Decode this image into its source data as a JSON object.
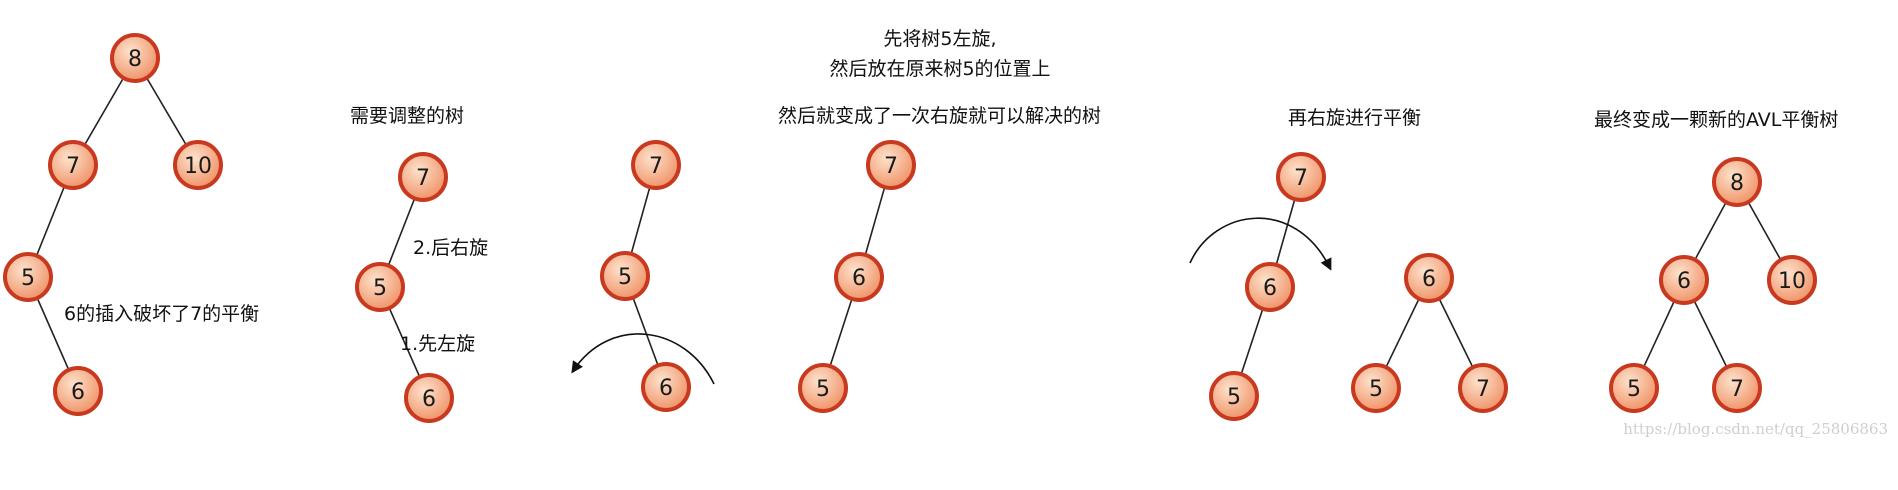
{
  "colors": {
    "node_fill_light": "#fde2cc",
    "node_fill_dark": "#ef8f63",
    "node_stroke": "#c8391f",
    "edge": "#222222",
    "text": "#111111",
    "watermark": "#cfcfcf"
  },
  "diagram": {
    "top_caption": [
      "先将树5左旋,",
      "然后放在原来树5的位置上"
    ],
    "panels": [
      {
        "id": "original",
        "captions": [
          "6的插入破坏了7的平衡"
        ],
        "nodes": [
          "8",
          "7",
          "10",
          "5",
          "6"
        ]
      },
      {
        "id": "subtree",
        "captions": [
          "需要调整的树",
          "2.后右旋",
          "1.先左旋"
        ],
        "nodes": [
          "7",
          "5",
          "6"
        ]
      },
      {
        "id": "left-rotate",
        "captions": [],
        "nodes": [
          "7",
          "5",
          "6"
        ]
      },
      {
        "id": "after-left",
        "captions": [
          "然后就变成了一次右旋就可以解决的树"
        ],
        "nodes": [
          "7",
          "6",
          "5"
        ]
      },
      {
        "id": "right-rotate",
        "captions": [
          "再右旋进行平衡"
        ],
        "nodes": [
          "7",
          "6",
          "5",
          "6",
          "5",
          "7"
        ]
      },
      {
        "id": "final",
        "captions": [
          "最终变成一颗新的AVL平衡树"
        ],
        "nodes": [
          "8",
          "6",
          "10",
          "5",
          "7"
        ]
      }
    ],
    "watermark": "https://blog.csdn.net/qq_25806863"
  }
}
